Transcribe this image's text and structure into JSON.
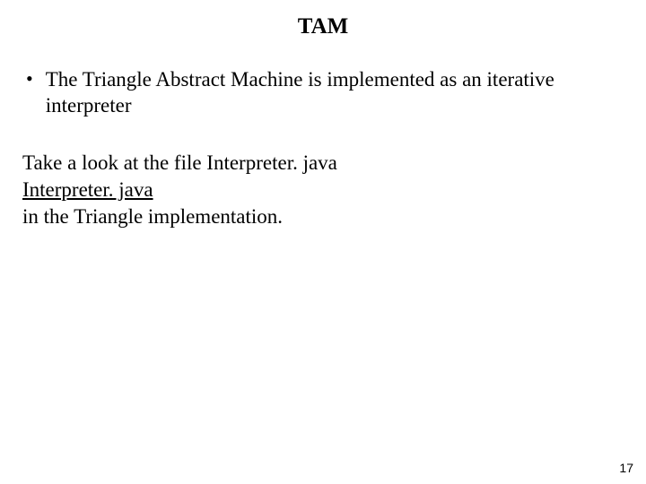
{
  "title": "TAM",
  "bullet1": "The Triangle Abstract Machine is implemented as an iterative interpreter",
  "body": {
    "line1": "Take a look at the file Interpreter. java",
    "link": "Interpreter. java",
    "line3": "in the Triangle implementation."
  },
  "pageNumber": "17"
}
